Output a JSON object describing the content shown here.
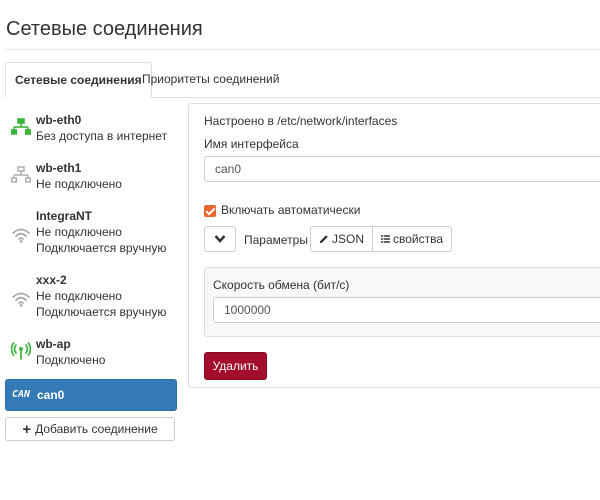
{
  "page": {
    "title": "Сетевые соединения"
  },
  "tabs": [
    {
      "label": "Сетевые соединения",
      "active": true
    },
    {
      "label": "Приоритеты соединений",
      "active": false
    }
  ],
  "connections": [
    {
      "name": "wb-eth0",
      "lines": [
        "Без доступа в интернет"
      ],
      "icon": "ethernet-connected-icon",
      "active": false
    },
    {
      "name": "wb-eth1",
      "lines": [
        "Не подключено"
      ],
      "icon": "ethernet-disconnected-icon",
      "active": false
    },
    {
      "name": "IntegraNT",
      "lines": [
        "Не подключено",
        "Подключается вручную"
      ],
      "icon": "wifi-disconnected-icon",
      "active": false
    },
    {
      "name": "xxx-2",
      "lines": [
        "Не подключено",
        "Подключается вручную"
      ],
      "icon": "wifi-disconnected-icon",
      "active": false
    },
    {
      "name": "wb-ap",
      "lines": [
        "Подключено"
      ],
      "icon": "access-point-icon",
      "active": false
    },
    {
      "name": "can0",
      "lines": [],
      "icon": "can-icon",
      "icon_text": "CAN",
      "active": true
    }
  ],
  "add_button": {
    "label": "Добавить соединение",
    "icon": "plus-icon"
  },
  "details": {
    "configured_in": "Настроено в /etc/network/interfaces",
    "iface_label": "Имя интерфейса",
    "iface_value": "can0",
    "auto_checked": true,
    "auto_label": "Включать автоматически",
    "params_label": "Параметры",
    "json_button": "JSON",
    "props_button": "свойства",
    "speed_label": "Скорость обмена (бит/с)",
    "speed_value": "1000000",
    "delete_button": "Удалить"
  },
  "colors": {
    "accent_blue": "#337ab7",
    "checkbox_orange": "#e8672f",
    "delete_red": "#a30c2b",
    "connected_green": "#3cb43c",
    "icon_gray": "#aaaaaa"
  }
}
